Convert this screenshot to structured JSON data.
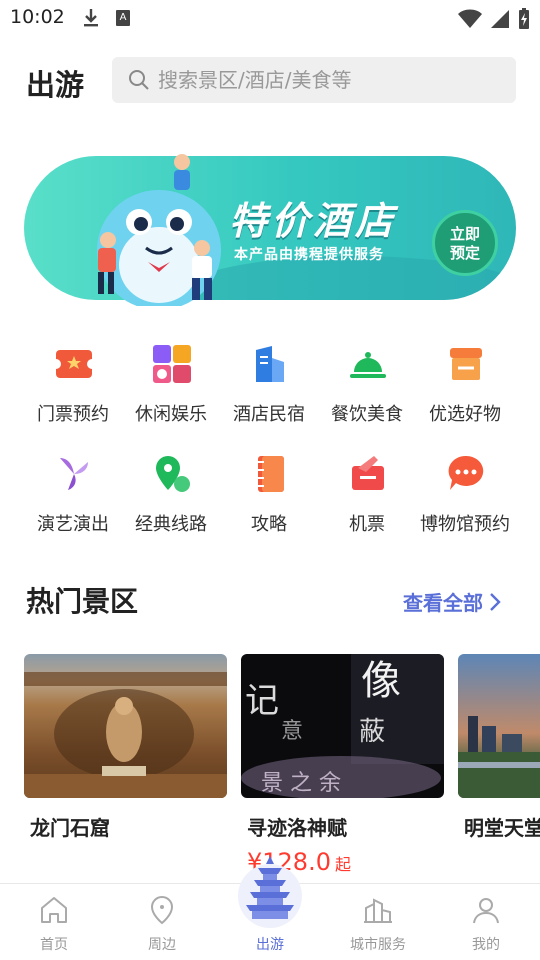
{
  "status_bar": {
    "time": "10:02"
  },
  "header": {
    "title": "出游",
    "search_placeholder": "搜索景区/酒店/美食等"
  },
  "banner": {
    "headline": "特价酒店",
    "subtitle": "本产品由携程提供服务",
    "cta_line1": "立即",
    "cta_line2": "预定",
    "colors": {
      "start": "#59dfc9",
      "end": "#2fb7b8",
      "cta": "#1f9e76"
    }
  },
  "categories": [
    {
      "label": "门票预约",
      "icon": "ticket-icon"
    },
    {
      "label": "休闲娱乐",
      "icon": "leisure-icon"
    },
    {
      "label": "酒店民宿",
      "icon": "hotel-icon"
    },
    {
      "label": "餐饮美食",
      "icon": "dining-icon"
    },
    {
      "label": "优选好物",
      "icon": "shop-icon"
    },
    {
      "label": "演艺演出",
      "icon": "performance-icon"
    },
    {
      "label": "经典线路",
      "icon": "route-icon"
    },
    {
      "label": "攻略",
      "icon": "guide-icon"
    },
    {
      "label": "机票",
      "icon": "flight-icon"
    },
    {
      "label": "博物馆预约",
      "icon": "museum-icon"
    }
  ],
  "hot_section": {
    "title": "热门景区",
    "see_all": "查看全部",
    "items": [
      {
        "name": "龙门石窟",
        "price": ""
      },
      {
        "name": "寻迹洛神赋",
        "price": "¥128.0",
        "price_suffix": "起"
      },
      {
        "name": "明堂天堂",
        "price": ""
      }
    ]
  },
  "bottom_nav": [
    {
      "label": "首页",
      "icon": "home-icon",
      "active": false
    },
    {
      "label": "周边",
      "icon": "location-pin-icon",
      "active": false
    },
    {
      "label": "出游",
      "icon": "pagoda-icon",
      "active": true
    },
    {
      "label": "城市服务",
      "icon": "city-icon",
      "active": false
    },
    {
      "label": "我的",
      "icon": "person-icon",
      "active": false
    }
  ],
  "accent_color": "#5a6fd8",
  "price_color": "#ff3b30"
}
